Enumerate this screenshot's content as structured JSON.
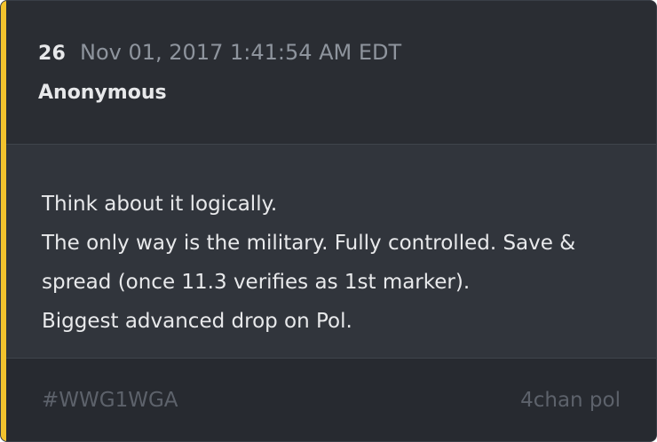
{
  "post": {
    "number": "26",
    "timestamp": "Nov 01, 2017 1:41:54 AM EDT",
    "author": "Anonymous",
    "message_lines": [
      "Think about it logically.",
      "The only way is the military. Fully controlled. Save &",
      "spread (once 11.3 verifies as 1st marker).",
      "Biggest advanced drop on Pol."
    ],
    "hashtag": "#WWG1WGA",
    "source": "4chan pol"
  },
  "colors": {
    "accent": "#f2c22d",
    "card_background": "#2b2e35",
    "body_background": "#31353c",
    "footer_background": "#272a30",
    "primary_text": "#e7e8ea",
    "muted_text": "#8e949d",
    "footer_text": "#5d626b"
  }
}
